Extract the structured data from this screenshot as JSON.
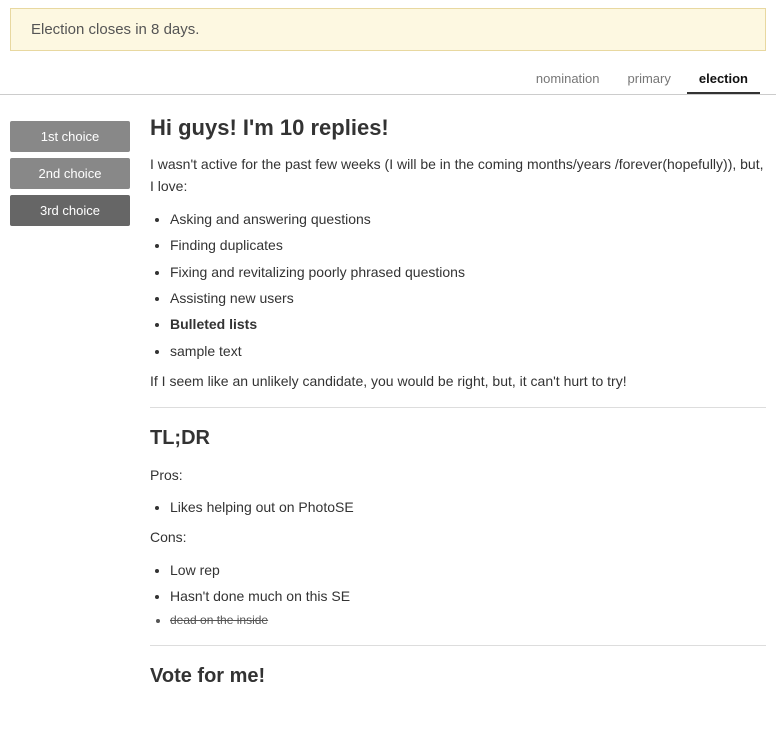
{
  "banner": {
    "text": "Election closes in 8 days."
  },
  "nav": {
    "tabs": [
      {
        "id": "nomination",
        "label": "nomination",
        "active": false
      },
      {
        "id": "primary",
        "label": "primary",
        "active": false
      },
      {
        "id": "election",
        "label": "election",
        "active": true
      }
    ]
  },
  "sidebar": {
    "buttons": [
      {
        "id": "choice1",
        "label": "1st choice"
      },
      {
        "id": "choice2",
        "label": "2nd choice"
      },
      {
        "id": "choice3",
        "label": "3rd choice"
      }
    ]
  },
  "post": {
    "title": "Hi guys! I'm 10 replies!",
    "intro": "I wasn't active for the past few weeks (I will be in the coming months/years /forever(hopefully)), but, I love:",
    "loves": [
      {
        "text": "Asking and answering questions",
        "bold": false,
        "strike": false
      },
      {
        "text": "Finding duplicates",
        "bold": false,
        "strike": false
      },
      {
        "text": "Fixing and revitalizing poorly phrased questions",
        "bold": false,
        "strike": false
      },
      {
        "text": "Assisting new users",
        "bold": false,
        "strike": false
      },
      {
        "text": "Bulleted lists",
        "bold": true,
        "strike": false
      },
      {
        "text": "sample text",
        "bold": false,
        "strike": false
      }
    ],
    "closing": "If I seem like an unlikely candidate, you would be right, but, it can't hurt to try!",
    "tldr_title": "TL;DR",
    "pros_label": "Pros:",
    "pros": [
      {
        "text": "Likes helping out on PhotoSE",
        "bold": false,
        "strike": false
      }
    ],
    "cons_label": "Cons:",
    "cons": [
      {
        "text": "Low rep",
        "bold": false,
        "strike": false
      },
      {
        "text": "Hasn't done much on this SE",
        "bold": false,
        "strike": false
      },
      {
        "text": "dead on the inside",
        "bold": false,
        "strike": true
      }
    ],
    "vote_title": "Vote for me!"
  }
}
